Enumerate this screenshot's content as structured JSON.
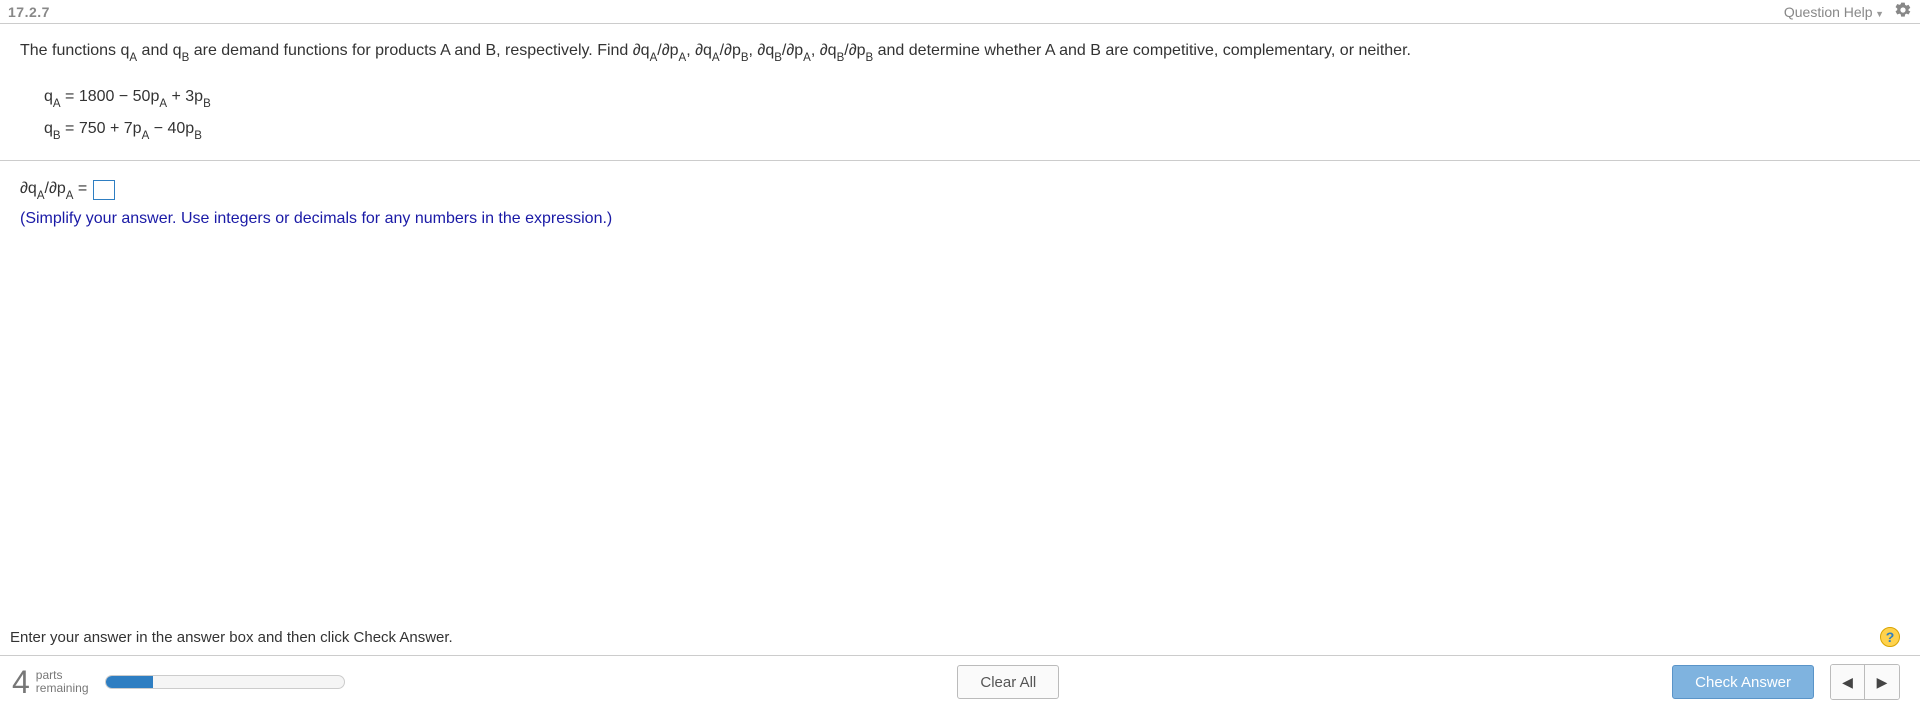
{
  "header": {
    "section_number": "17.2.7",
    "help_label": "Question Help"
  },
  "problem": {
    "intro_a": "The functions q",
    "intro_b": " and q",
    "intro_c": " are demand functions for products A and B, respectively. Find ∂q",
    "sep": ", ∂q",
    "intro_end": " and determine whether A and B are competitive, complementary, or neither.",
    "sub_A": "A",
    "sub_B": "B",
    "slash_pA": "/∂p",
    "slash_pB": "/∂p"
  },
  "equations": {
    "qA_lhs": "q",
    "qA_rhs_a": " = 1800 − 50p",
    "qA_rhs_b": " + 3p",
    "qB_lhs": "q",
    "qB_rhs_a": " = 750 + 7p",
    "qB_rhs_b": " − 40p"
  },
  "answer": {
    "lhs_a": "∂q",
    "lhs_b": "/∂p",
    "equals": " = ",
    "value": "",
    "hint": "(Simplify your answer. Use integers or decimals for any numbers in the expression.)"
  },
  "instruction": "Enter your answer in the answer box and then click Check Answer.",
  "footer": {
    "parts_number": "4",
    "parts_label_top": "parts",
    "parts_label_bottom": "remaining",
    "progress_percent": 20,
    "clear_label": "Clear All",
    "check_label": "Check Answer",
    "help_char": "?"
  }
}
